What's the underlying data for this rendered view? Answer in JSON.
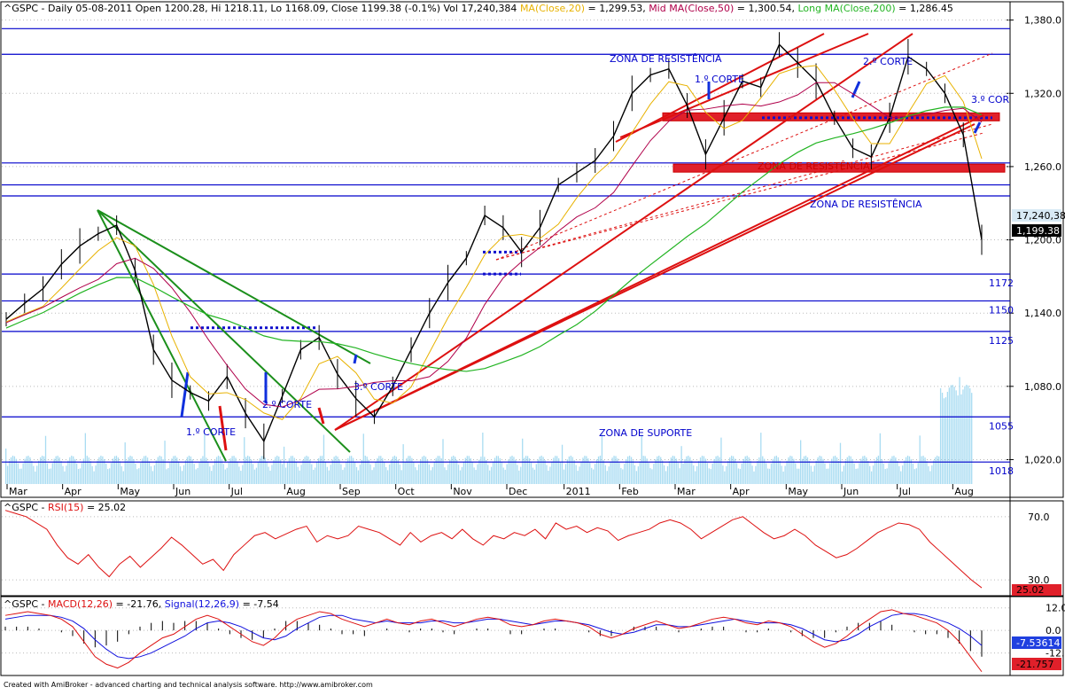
{
  "app": {
    "footer": "Created with AmiBroker - advanced charting and technical analysis software. http://www.amibroker.com"
  },
  "colors": {
    "background": "#ffffff",
    "price": "#000000",
    "ma20": "#e8b200",
    "ma50": "#b0004a",
    "ma200": "#22b422",
    "trend_green": "#1b8f1b",
    "trend_red": "#dd1010",
    "hlines": "#0000cc",
    "volume": "#a9dcf2",
    "rsi": "#dd1010",
    "macd": "#dd1010",
    "signal": "#1010dd"
  },
  "header": {
    "price_title": {
      "symbol": "^GSPC - Daily 05-08-2011 Open 1200.28, Hi 1218.11, Lo 1168.09, Close 1199.38 (-0.1%) Vol 17,240,384",
      "ma20_label": "MA(Close,20)",
      "ma20_value": " = 1,299.53, ",
      "ma50_label": "Mid MA(Close,50)",
      "ma50_value": " = 1,300.54, ",
      "ma200_label": "Long MA(Close,200)",
      "ma200_value": " = 1,286.45"
    },
    "rsi_title": {
      "prefix": "^GSPC - ",
      "label": "RSI(15)",
      "value": " = 25.02"
    },
    "macd_title": {
      "prefix": "^GSPC - ",
      "macd_label": "MACD(12,26)",
      "macd_value": " = -21.76, ",
      "signal_label": "Signal(12,26,9)",
      "signal_value": " = -7.54"
    }
  },
  "chart_data": [
    {
      "type": "candlestick",
      "symbol": "^GSPC",
      "interval": "Daily",
      "last_bar": {
        "date": "05-08-2011",
        "open": 1200.28,
        "high": 1218.11,
        "low": 1168.09,
        "close": 1199.38,
        "change_pct": -0.1,
        "volume": 17240384
      },
      "moving_averages": {
        "MA(Close,20)": 1299.53,
        "Mid MA(Close,50)": 1300.54,
        "Long MA(Close,200)": 1286.45
      },
      "x_ticks": [
        "Mar",
        "Apr",
        "May",
        "Jun",
        "Jul",
        "Aug",
        "Sep",
        "Oct",
        "Nov",
        "Dec",
        "2011",
        "Feb",
        "Mar",
        "Apr",
        "May",
        "Jun",
        "Jul",
        "Aug"
      ],
      "y_ticks": [
        1020,
        1080,
        1140,
        1200,
        1260,
        1320,
        1380
      ],
      "y_tick_labels": [
        "1,020.0",
        "1,080.0",
        "1,140.0",
        "1,200.0",
        "1,260.0",
        "1,320.0",
        "1,380.0"
      ],
      "ylim": [
        1000,
        1395
      ],
      "price_series": [
        [
          "Mar",
          1135
        ],
        [
          "Mar",
          1148
        ],
        [
          "Mar",
          1160
        ],
        [
          "Apr",
          1180
        ],
        [
          "Apr",
          1195
        ],
        [
          "Apr",
          1205
        ],
        [
          "Apr",
          1212
        ],
        [
          "May",
          1175
        ],
        [
          "May",
          1110
        ],
        [
          "May",
          1085
        ],
        [
          "May",
          1075
        ],
        [
          "Jun",
          1068
        ],
        [
          "Jun",
          1088
        ],
        [
          "Jun",
          1058
        ],
        [
          "Jul",
          1035
        ],
        [
          "Jul",
          1072
        ],
        [
          "Jul",
          1110
        ],
        [
          "Aug",
          1120
        ],
        [
          "Aug",
          1090
        ],
        [
          "Aug",
          1070
        ],
        [
          "Sep",
          1055
        ],
        [
          "Sep",
          1080
        ],
        [
          "Sep",
          1110
        ],
        [
          "Oct",
          1140
        ],
        [
          "Oct",
          1165
        ],
        [
          "Oct",
          1185
        ],
        [
          "Nov",
          1220
        ],
        [
          "Nov",
          1210
        ],
        [
          "Nov",
          1190
        ],
        [
          "Dec",
          1210
        ],
        [
          "Dec",
          1245
        ],
        [
          "Dec",
          1255
        ],
        [
          "2011",
          1265
        ],
        [
          "2011",
          1285
        ],
        [
          "Feb",
          1320
        ],
        [
          "Feb",
          1335
        ],
        [
          "Feb",
          1340
        ],
        [
          "Mar",
          1310
        ],
        [
          "Mar",
          1270
        ],
        [
          "Mar",
          1300
        ],
        [
          "Apr",
          1330
        ],
        [
          "Apr",
          1325
        ],
        [
          "May",
          1360
        ],
        [
          "May",
          1345
        ],
        [
          "May",
          1330
        ],
        [
          "Jun",
          1300
        ],
        [
          "Jun",
          1275
        ],
        [
          "Jun",
          1268
        ],
        [
          "Jul",
          1300
        ],
        [
          "Jul",
          1350
        ],
        [
          "Jul",
          1340
        ],
        [
          "Jul",
          1320
        ],
        [
          "Aug",
          1286
        ],
        [
          "Aug",
          1200
        ]
      ],
      "annotations": {
        "resistance_labels": [
          "ZONA DE RESISTÊNCIA",
          "ZONA DE RESISTÊNCIA",
          "ZONA DE RESISTÊNCIA"
        ],
        "support_label": "ZONA DE SUPORTE",
        "break_labels": [
          "1.º CORTE",
          "2.º CORTE",
          "3.º CORTE",
          "1.º CORTE",
          "2.º CORTE",
          "3.º COR"
        ],
        "level_labels": [
          {
            "level": 1172,
            "label": "1172"
          },
          {
            "level": 1150,
            "label": "1150"
          },
          {
            "level": 1125,
            "label": "1125"
          },
          {
            "level": 1055,
            "label": "1055"
          },
          {
            "level": 1018,
            "label": "1018"
          }
        ],
        "price_badges": [
          "17,240,38",
          "1,199.38"
        ]
      }
    },
    {
      "type": "line",
      "name": "RSI(15)",
      "last_value": 25.02,
      "y_ticks": [
        30,
        70
      ],
      "y_tick_labels": [
        "30.0",
        "70.0"
      ],
      "ylim": [
        20,
        80
      ],
      "values": [
        74,
        72,
        70,
        66,
        62,
        52,
        44,
        40,
        46,
        38,
        32,
        40,
        45,
        38,
        44,
        50,
        57,
        52,
        46,
        40,
        43,
        36,
        46,
        52,
        58,
        60,
        56,
        59,
        62,
        64,
        54,
        58,
        56,
        58,
        64,
        62,
        60,
        56,
        52,
        60,
        54,
        58,
        60,
        56,
        62,
        56,
        52,
        58,
        56,
        60,
        58,
        62,
        56,
        66,
        62,
        64,
        60,
        63,
        61,
        55,
        58,
        60,
        62,
        66,
        68,
        66,
        62,
        56,
        60,
        64,
        68,
        70,
        65,
        60,
        56,
        58,
        62,
        58,
        52,
        48,
        44,
        46,
        50,
        55,
        60,
        63,
        66,
        65,
        62,
        54,
        48,
        42,
        36,
        30,
        25
      ],
      "value_badge": "25.02"
    },
    {
      "type": "line",
      "name": "MACD(12,26)",
      "last_value": -21.76,
      "signal_name": "Signal(12,26,9)",
      "signal_last_value": -7.54,
      "y_ticks": [
        -12,
        0,
        12
      ],
      "y_tick_labels": [
        "-12.0",
        "0.0",
        "12.0"
      ],
      "ylim": [
        -24,
        18
      ],
      "macd": [
        8,
        9,
        10,
        9,
        8,
        6,
        2,
        -6,
        -14,
        -18,
        -20,
        -17,
        -12,
        -8,
        -4,
        -2,
        2,
        6,
        8,
        6,
        2,
        -2,
        -6,
        -8,
        -4,
        2,
        6,
        8,
        10,
        9,
        6,
        4,
        2,
        4,
        6,
        4,
        3,
        5,
        6,
        4,
        2,
        4,
        6,
        7,
        6,
        3,
        2,
        3,
        5,
        6,
        5,
        4,
        2,
        -2,
        -4,
        -2,
        1,
        3,
        5,
        3,
        1,
        2,
        4,
        6,
        7,
        6,
        4,
        3,
        5,
        4,
        2,
        -2,
        -6,
        -9,
        -7,
        -3,
        2,
        6,
        10,
        11,
        9,
        8,
        6,
        4,
        0,
        -6,
        -14,
        -22
      ],
      "signal": [
        6,
        7,
        8,
        8,
        8,
        7,
        5,
        1,
        -5,
        -10,
        -14,
        -15,
        -14,
        -12,
        -9,
        -6,
        -3,
        1,
        4,
        5,
        4,
        2,
        -1,
        -4,
        -5,
        -3,
        1,
        4,
        7,
        8,
        8,
        6,
        5,
        4,
        5,
        4,
        4,
        4,
        5,
        5,
        4,
        4,
        5,
        6,
        6,
        5,
        4,
        3,
        4,
        5,
        5,
        4,
        3,
        1,
        -1,
        -2,
        -1,
        1,
        3,
        3,
        2,
        2,
        3,
        4,
        5,
        6,
        5,
        4,
        4,
        4,
        3,
        1,
        -2,
        -5,
        -6,
        -5,
        -2,
        2,
        5,
        8,
        9,
        9,
        8,
        6,
        4,
        1,
        -3,
        -8
      ],
      "value_badges": [
        "-7.53614",
        "-21.757"
      ]
    }
  ]
}
